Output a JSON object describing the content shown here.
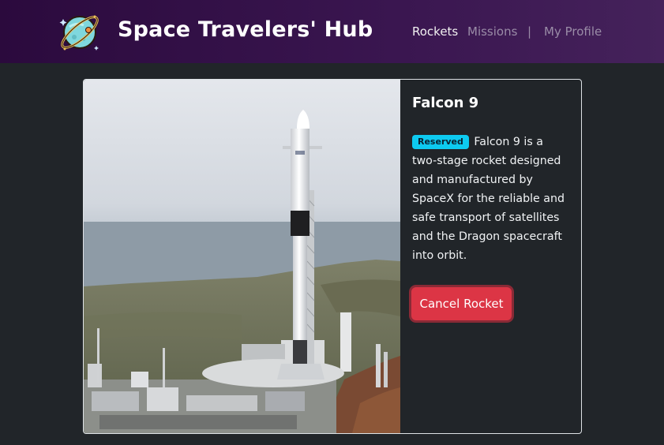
{
  "header": {
    "brand": "Space Travelers' Hub",
    "logo_icon": "planet-logo-icon"
  },
  "nav": {
    "rockets": "Rockets",
    "missions": "Missions",
    "divider": "|",
    "profile": "My Profile",
    "active": "Rockets"
  },
  "rocket": {
    "name": "Falcon 9",
    "badge": "Reserved",
    "description": "Falcon 9 is a two-stage rocket designed and manufactured by SpaceX for the reliable and safe transport of satellites and the Dragon spacecraft into orbit.",
    "button_label": "Cancel Rocket",
    "image_icon": "rocket-launch-photo"
  },
  "colors": {
    "navbar_start": "#2b0a3d",
    "navbar_end": "#45225b",
    "page_bg": "#212529",
    "badge_bg": "#0dcaf0",
    "button_bg": "#dc3545"
  }
}
